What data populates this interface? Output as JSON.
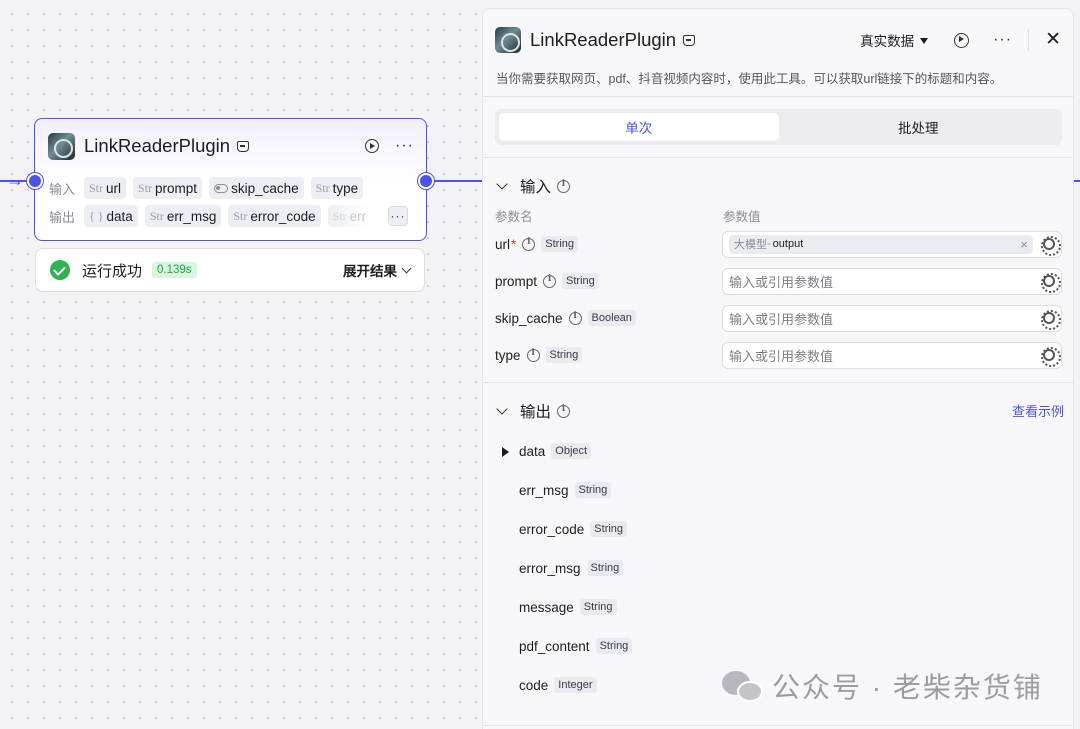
{
  "node": {
    "title": "LinkReaderPlugin",
    "input_label": "输入",
    "output_label": "输出",
    "inputs": [
      {
        "type": "Str",
        "name": "url"
      },
      {
        "type": "Str",
        "name": "prompt"
      },
      {
        "type": "",
        "name": "skip_cache"
      },
      {
        "type": "Str",
        "name": "type"
      }
    ],
    "outputs": [
      {
        "type": "{ }",
        "name": "data"
      },
      {
        "type": "Str",
        "name": "err_msg"
      },
      {
        "type": "Str",
        "name": "error_code"
      },
      {
        "type": "Str",
        "name": "err"
      }
    ]
  },
  "run_result": {
    "status": "运行成功",
    "time": "0.139s",
    "expand_label": "展开结果"
  },
  "panel": {
    "title": "LinkReaderPlugin",
    "data_mode": "真实数据",
    "description": "当你需要获取网页、pdf、抖音视频内容时，使用此工具。可以获取url链接下的标题和内容。",
    "tabs": [
      "单次",
      "批处理"
    ],
    "active_tab": "单次",
    "input_section": {
      "title": "输入",
      "col_name": "参数名",
      "col_value": "参数值",
      "params": [
        {
          "name": "url",
          "required": "*",
          "type": "String",
          "ref_node": "大模型",
          "ref_sep": " - ",
          "ref_var": "output",
          "placeholder": ""
        },
        {
          "name": "prompt",
          "required": "",
          "type": "String",
          "placeholder": "输入或引用参数值"
        },
        {
          "name": "skip_cache",
          "required": "",
          "type": "Boolean",
          "placeholder": "输入或引用参数值"
        },
        {
          "name": "type",
          "required": "",
          "type": "String",
          "placeholder": "输入或引用参数值"
        }
      ]
    },
    "output_section": {
      "title": "输出",
      "see_example": "查看示例",
      "fields": [
        {
          "name": "data",
          "type": "Object"
        },
        {
          "name": "err_msg",
          "type": "String"
        },
        {
          "name": "error_code",
          "type": "String"
        },
        {
          "name": "error_msg",
          "type": "String"
        },
        {
          "name": "message",
          "type": "String"
        },
        {
          "name": "pdf_content",
          "type": "String"
        },
        {
          "name": "code",
          "type": "Integer"
        }
      ]
    }
  },
  "watermark": "公众号 · 老柴杂货铺",
  "colors": {
    "accent": "#4d53e8",
    "success": "#2cb452",
    "required": "#e5393a"
  }
}
